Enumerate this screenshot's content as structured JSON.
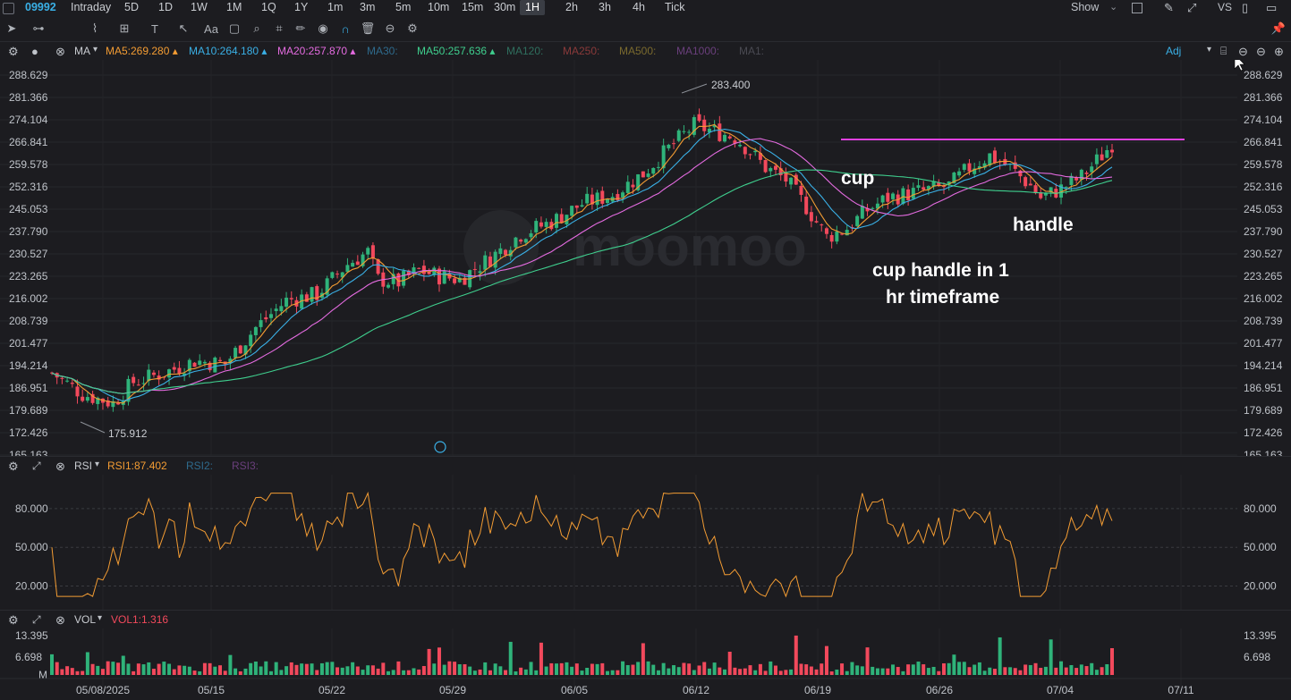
{
  "header": {
    "ticker": "09992",
    "timeframes": [
      "Intraday",
      "5D",
      "1D",
      "1W",
      "1M",
      "1Q",
      "1Y",
      "1m",
      "3m",
      "5m",
      "10m",
      "15m",
      "30m",
      "1H",
      "2h",
      "3h",
      "4h",
      "Tick"
    ],
    "active_timeframe": "1H",
    "show_label": "Show",
    "vs_label": "VS"
  },
  "ma_bar": {
    "indicator": "MA",
    "items": [
      {
        "label": "MA5:269.280",
        "color": "#f39c33"
      },
      {
        "label": "MA10:264.180",
        "color": "#3ab0e6"
      },
      {
        "label": "MA20:257.870",
        "color": "#e46be0"
      },
      {
        "label": "MA30:",
        "color": "#2e6a8c"
      },
      {
        "label": "MA50:257.636",
        "color": "#3fcf8e"
      },
      {
        "label": "MA120:",
        "color": "#2f6f5e"
      },
      {
        "label": "MA250:",
        "color": "#8a3a3a"
      },
      {
        "label": "MA500:",
        "color": "#7a6a2e"
      },
      {
        "label": "MA1000:",
        "color": "#6a3f7c"
      },
      {
        "label": "MA1:",
        "color": "#4a4a52"
      }
    ],
    "adj_label": "Adj"
  },
  "price_axis": [
    "288.629",
    "281.366",
    "274.104",
    "266.841",
    "259.578",
    "252.316",
    "245.053",
    "237.790",
    "230.527",
    "223.265",
    "216.002",
    "208.739",
    "201.477",
    "194.214",
    "186.951",
    "179.689",
    "172.426",
    "165.163"
  ],
  "extremes": {
    "high": "283.400",
    "low": "175.912"
  },
  "watermark": "moomoo",
  "annotations": {
    "cup": "cup",
    "handle": "handle",
    "note_line1": "cup handle in 1",
    "note_line2": "hr timeframe"
  },
  "rsi": {
    "name": "RSI",
    "rsi1": "RSI1:87.402",
    "rsi2": "RSI2:",
    "rsi3": "RSI3:",
    "levels": [
      "80.000",
      "50.000",
      "20.000"
    ]
  },
  "vol": {
    "name": "VOL",
    "vol1": "VOL1:1.316",
    "levels": [
      "13.395",
      "6.698",
      "M"
    ]
  },
  "dates": [
    "05/08/2025",
    "05/15",
    "05/22",
    "05/29",
    "06/05",
    "06/12",
    "06/19",
    "06/26",
    "07/04",
    "07/11"
  ],
  "colors": {
    "up": "#2fb37a",
    "down": "#f2495c",
    "ma5": "#f39c33",
    "ma10": "#3ab0e6",
    "ma20": "#e46be0",
    "ma50": "#3fcf8e",
    "resistance": "#e040e0",
    "rsi": "#f39c33"
  },
  "chart_data": {
    "type": "candlestick",
    "close_path": [
      [
        0,
        190
      ],
      [
        6,
        183
      ],
      [
        12,
        180
      ],
      [
        16,
        187
      ],
      [
        22,
        190
      ],
      [
        28,
        194
      ],
      [
        34,
        193
      ],
      [
        40,
        205
      ],
      [
        46,
        214
      ],
      [
        52,
        216
      ],
      [
        58,
        226
      ],
      [
        62,
        230
      ],
      [
        64,
        221
      ],
      [
        68,
        220
      ],
      [
        72,
        224
      ],
      [
        76,
        222
      ],
      [
        80,
        221
      ],
      [
        86,
        228
      ],
      [
        92,
        236
      ],
      [
        98,
        240
      ],
      [
        104,
        246
      ],
      [
        110,
        249
      ],
      [
        116,
        256
      ],
      [
        122,
        266
      ],
      [
        126,
        272
      ],
      [
        130,
        270
      ],
      [
        134,
        268
      ],
      [
        136,
        265
      ],
      [
        140,
        258
      ],
      [
        144,
        254
      ],
      [
        148,
        245
      ],
      [
        152,
        235
      ],
      [
        156,
        238
      ],
      [
        160,
        244
      ],
      [
        164,
        248
      ],
      [
        170,
        250
      ],
      [
        176,
        252
      ],
      [
        180,
        258
      ],
      [
        184,
        262
      ],
      [
        188,
        258
      ],
      [
        192,
        252
      ],
      [
        194,
        248
      ],
      [
        198,
        251
      ],
      [
        202,
        255
      ],
      [
        206,
        262
      ],
      [
        208,
        266
      ]
    ],
    "resistance_level": 266.841,
    "ylim": [
      165.163,
      288.629
    ]
  }
}
